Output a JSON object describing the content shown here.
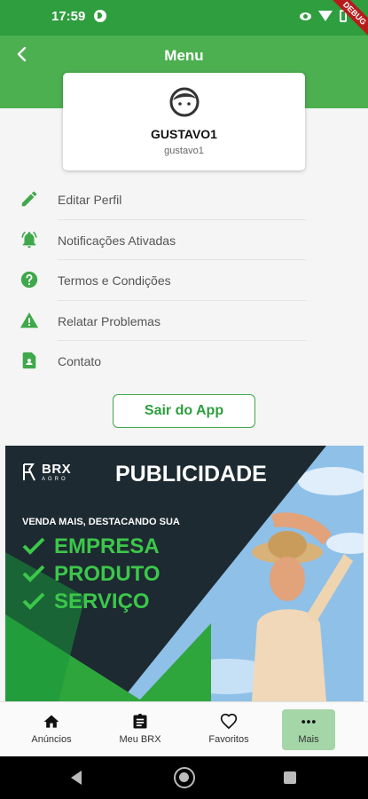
{
  "status_bar": {
    "time": "17:59",
    "debug_label": "DEBUG"
  },
  "header": {
    "title": "Menu"
  },
  "profile": {
    "name": "GUSTAVO1",
    "username": "gustavo1"
  },
  "menu": {
    "items": [
      {
        "label": "Editar Perfil",
        "icon": "pencil-icon"
      },
      {
        "label": "Notificações Ativadas",
        "icon": "bell-ringing-icon"
      },
      {
        "label": "Termos e Condições",
        "icon": "help-circle-icon"
      },
      {
        "label": "Relatar Problemas",
        "icon": "warning-icon"
      },
      {
        "label": "Contato",
        "icon": "contact-icon"
      }
    ]
  },
  "logout_label": "Sair do App",
  "ad": {
    "brand": "BRX",
    "brand_sub": "AGRO",
    "headline": "PUBLICIDADE",
    "tagline": "VENDA MAIS, DESTACANDO SUA",
    "bullets": [
      "EMPRESA",
      "PRODUTO",
      "SERVIÇO"
    ]
  },
  "bottom_nav": {
    "items": [
      {
        "label": "Anúncios",
        "icon": "home-icon",
        "active": false
      },
      {
        "label": "Meu BRX",
        "icon": "clipboard-icon",
        "active": false
      },
      {
        "label": "Favoritos",
        "icon": "heart-icon",
        "active": false
      },
      {
        "label": "Mais",
        "icon": "more-icon",
        "active": true
      }
    ]
  },
  "colors": {
    "primary": "#4caf50",
    "primary_dark": "#2e9e3e",
    "accent_green": "#3cc74a",
    "active_tab": "#a5d6a7"
  }
}
